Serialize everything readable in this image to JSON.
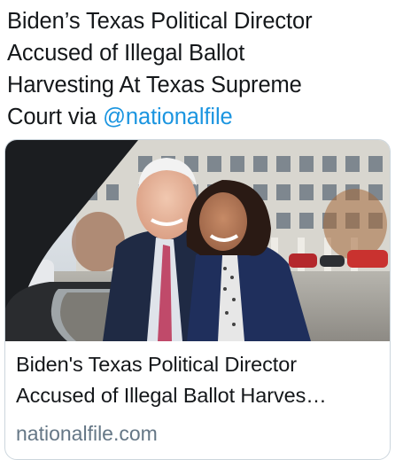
{
  "tweet": {
    "text_lines": [
      "Biden’s Texas Political Director",
      "Accused of Illegal Ballot",
      "Harvesting At Texas Supreme"
    ],
    "last_line_prefix": "Court via ",
    "mention": "@nationalfile"
  },
  "card": {
    "image_icon": "photo-icon",
    "title_lines": [
      "Biden's Texas Political Director",
      "Accused of Illegal Ballot Harves…"
    ],
    "domain": "nationalfile.com"
  },
  "colors": {
    "text": "#14171a",
    "mention": "#1b95e0",
    "muted": "#657786",
    "border": "#ccd6dd"
  }
}
